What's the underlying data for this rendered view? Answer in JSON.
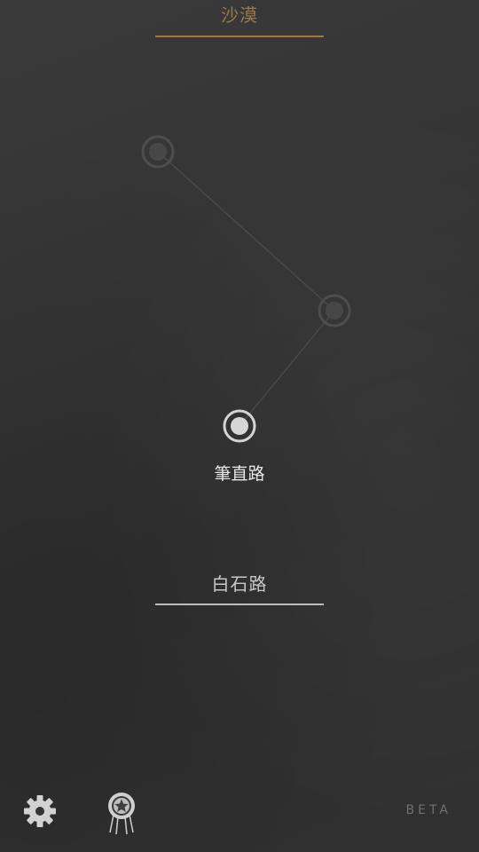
{
  "header": {
    "tab_label": "沙漠"
  },
  "map": {
    "current_node_label": "筆直路",
    "node_accent": "#d9d9d9",
    "locked_node_color": "#555555"
  },
  "footer_tab": {
    "label": "白石路"
  },
  "toolbar": {
    "settings_icon": "gear-icon",
    "achievements_icon": "medal-ribbon-icon",
    "beta_label": "BETA"
  },
  "colors": {
    "background": "#333333",
    "accent_gold": "#a07a3a",
    "text_light": "#e8e8e8"
  }
}
